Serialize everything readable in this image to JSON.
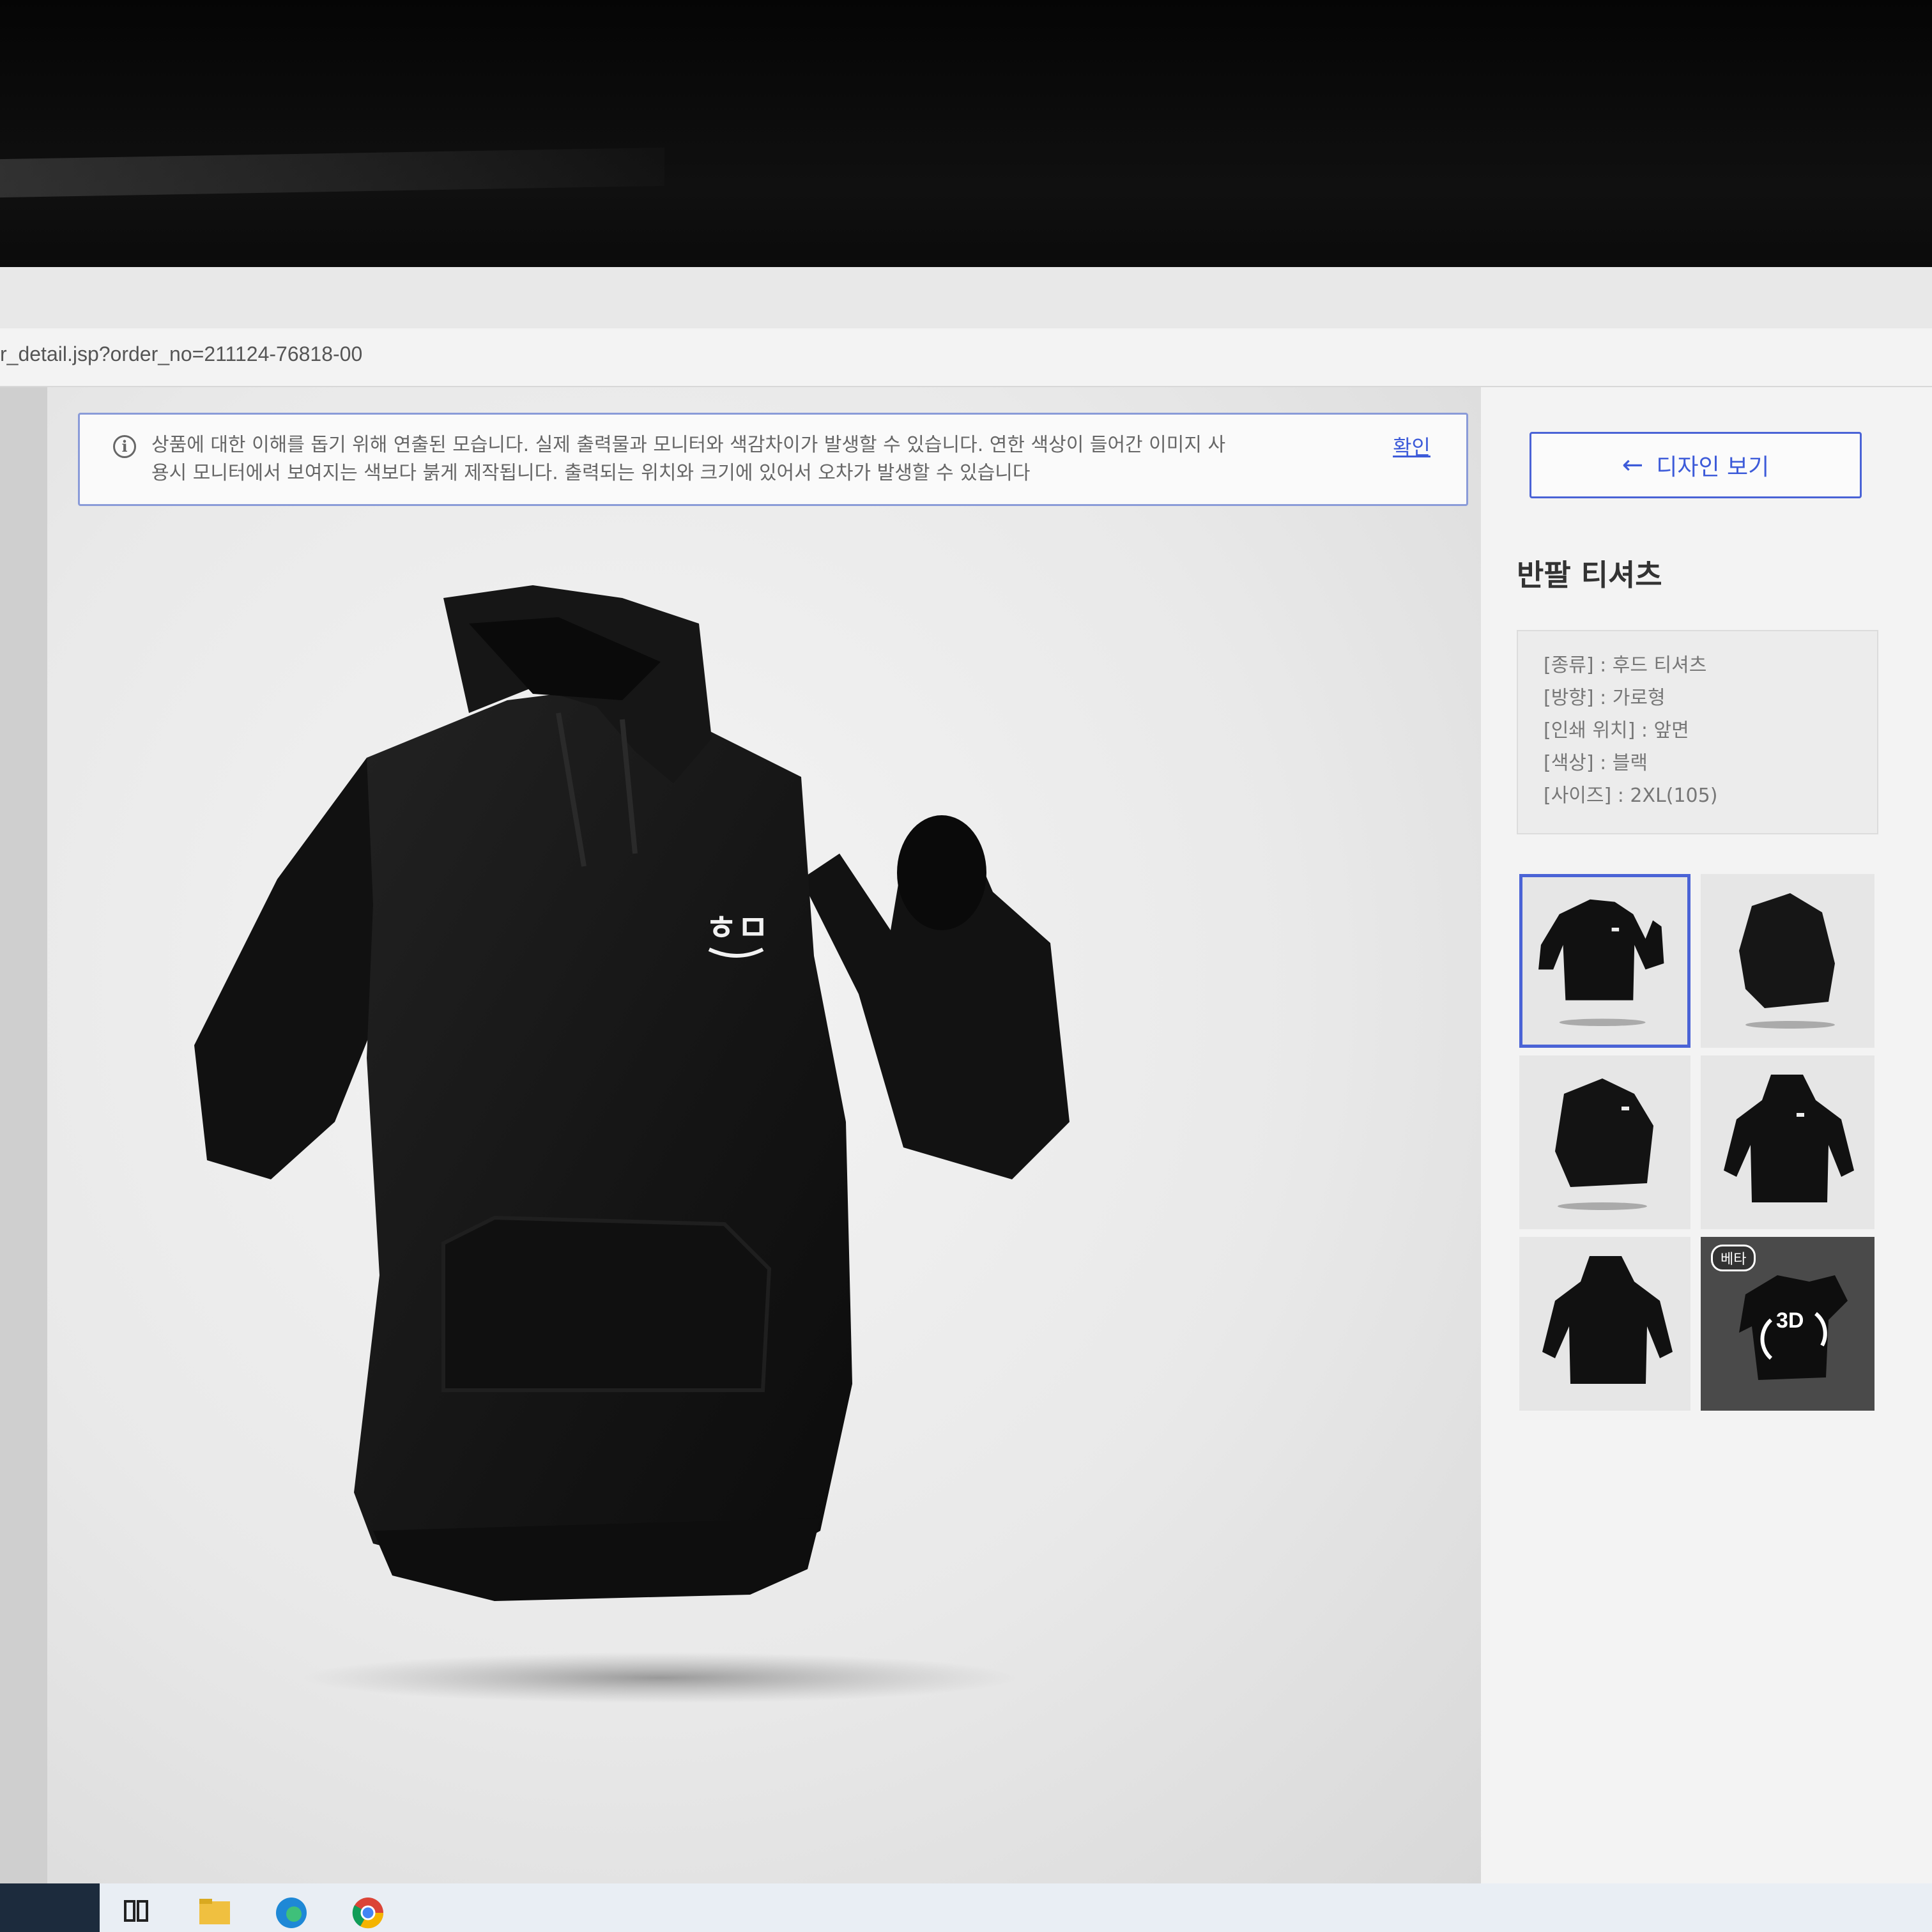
{
  "browser": {
    "url": "r_detail.jsp?order_no=211124-76818-00"
  },
  "notice": {
    "line1": "상품에 대한 이해를 돕기 위해 연출된 모습니다. 실제 출력물과 모니터와 색감차이가 발생할 수 있습니다. 연한 색상이 들어간 이미지 사",
    "line2": "용시 모니터에서 보여지는 색보다 붉게 제작됩니다. 출력되는 위치와 크기에 있어서 오차가 발생할 수 있습니다",
    "confirm_label": "확인"
  },
  "viewer": {
    "logo_text": "ㅎㅁ"
  },
  "sidebar": {
    "design_button_label": "디자인 보기",
    "product_title": "반팔 티셔츠",
    "info": [
      "[종류] : 후드 티셔츠",
      "[방향] : 가로형",
      "[인쇄 위치] : 앞면",
      "[색상] : 블랙",
      "[사이즈] : 2XL(105)"
    ],
    "beta_badge": "베타",
    "badge_3d": "3D"
  },
  "colors": {
    "accent": "#4a63d6",
    "link": "#3d5bd9",
    "hoodie": "#141414"
  }
}
